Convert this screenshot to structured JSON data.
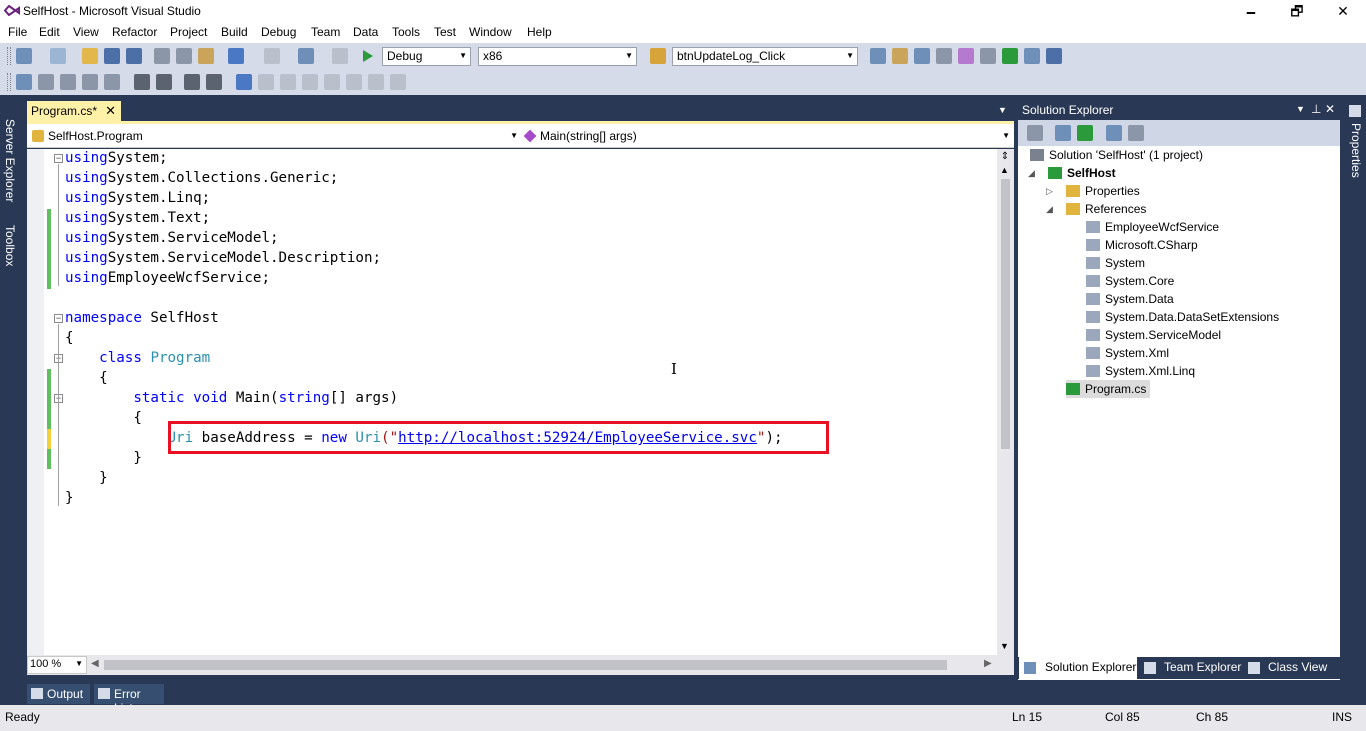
{
  "window": {
    "title": "SelfHost - Microsoft Visual Studio",
    "minimize": "🗕",
    "maximize": "🗗",
    "close": "✕"
  },
  "menu": [
    "File",
    "Edit",
    "View",
    "Refactor",
    "Project",
    "Build",
    "Debug",
    "Team",
    "Data",
    "Tools",
    "Test",
    "Window",
    "Help"
  ],
  "toolbar": {
    "configuration": "Debug",
    "platform": "x86",
    "find": "btnUpdateLog_Click"
  },
  "side_tabs": {
    "left": [
      "Server Explorer",
      "Toolbox"
    ],
    "right": [
      "Properties"
    ]
  },
  "editor": {
    "tab_label": "Program.cs*",
    "nav_left": "SelfHost.Program",
    "nav_right": "Main(string[] args)",
    "zoom": "100 %",
    "lines": [
      [
        [
          "kw",
          "using"
        ],
        [
          "",
          "System;"
        ]
      ],
      [
        [
          "kw",
          "using"
        ],
        [
          "",
          "System.Collections.Generic;"
        ]
      ],
      [
        [
          "kw",
          "using"
        ],
        [
          "",
          "System.Linq;"
        ]
      ],
      [
        [
          "kw",
          "using"
        ],
        [
          "",
          "System.Text;"
        ]
      ],
      [
        [
          "kw",
          "using"
        ],
        [
          "",
          "System.ServiceModel;"
        ]
      ],
      [
        [
          "kw",
          "using"
        ],
        [
          "",
          "System.ServiceModel.Description;"
        ]
      ],
      [
        [
          "kw",
          "using"
        ],
        [
          "",
          "EmployeeWcfService;"
        ]
      ],
      [],
      [
        [
          "kw",
          "namespace"
        ],
        [
          "",
          " SelfHost"
        ]
      ],
      [
        [
          "",
          "{"
        ]
      ],
      [
        [
          "",
          "    "
        ],
        [
          "kw",
          "class"
        ],
        [
          "",
          " "
        ],
        [
          "ty",
          "Program"
        ]
      ],
      [
        [
          "",
          "    {"
        ]
      ],
      [
        [
          "",
          "        "
        ],
        [
          "kw",
          "static"
        ],
        [
          "",
          " "
        ],
        [
          "kw",
          "void"
        ],
        [
          "",
          " Main("
        ],
        [
          "kw",
          "string"
        ],
        [
          "",
          "[] args)"
        ]
      ],
      [
        [
          "",
          "        {"
        ]
      ],
      [
        [
          "",
          "            "
        ],
        [
          "ty",
          "Uri"
        ],
        [
          "",
          " baseAddress = "
        ],
        [
          "kw",
          "new"
        ],
        [
          "",
          " "
        ],
        [
          "ty",
          "Uri"
        ],
        [
          "st",
          "(\""
        ],
        [
          "lnk",
          "http://localhost:52924/EmployeeService.svc"
        ],
        [
          "st",
          "\""
        ],
        [
          "",
          ");"
        ]
      ],
      [
        [
          "",
          "        }"
        ]
      ],
      [
        [
          "",
          "    }"
        ]
      ],
      [
        [
          "",
          "}"
        ]
      ]
    ]
  },
  "solution_explorer": {
    "title": "Solution Explorer",
    "tree": [
      {
        "label": "Solution 'SelfHost' (1 project)",
        "level": 0
      },
      {
        "label": "SelfHost",
        "level": 1,
        "bold": true,
        "expander": "◢"
      },
      {
        "label": "Properties",
        "level": 2,
        "expander": "▷"
      },
      {
        "label": "References",
        "level": 2,
        "expander": "◢"
      },
      {
        "label": "EmployeeWcfService",
        "level": 3
      },
      {
        "label": "Microsoft.CSharp",
        "level": 3
      },
      {
        "label": "System",
        "level": 3
      },
      {
        "label": "System.Core",
        "level": 3
      },
      {
        "label": "System.Data",
        "level": 3
      },
      {
        "label": "System.Data.DataSetExtensions",
        "level": 3
      },
      {
        "label": "System.ServiceModel",
        "level": 3
      },
      {
        "label": "System.Xml",
        "level": 3
      },
      {
        "label": "System.Xml.Linq",
        "level": 3
      },
      {
        "label": "Program.cs",
        "level": 2,
        "selected": true
      }
    ],
    "bottom_tabs": [
      "Solution Explorer",
      "Team Explorer",
      "Class View"
    ]
  },
  "bottom_tabs": [
    "Output",
    "Error List"
  ],
  "status": {
    "text": "Ready",
    "ln": "Ln 15",
    "col": "Col 85",
    "ch": "Ch 85",
    "mode": "INS"
  },
  "colors": {
    "accent_tab": "#fff1a8",
    "chrome": "#293955",
    "highlight_box": "#e81123"
  }
}
